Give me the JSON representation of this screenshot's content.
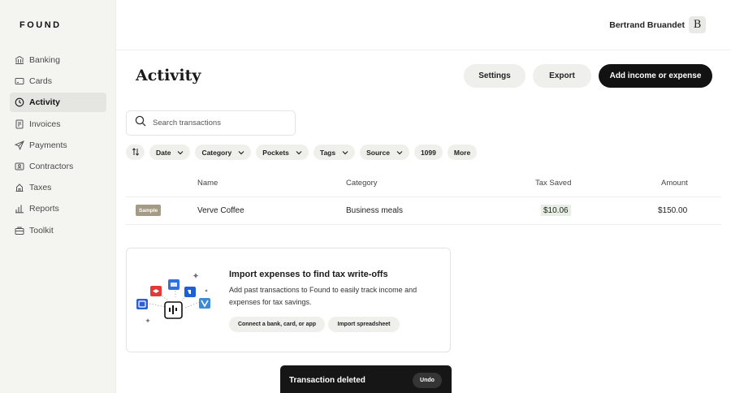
{
  "brand": {
    "logo_text": "FOUND"
  },
  "sidebar": {
    "items": [
      {
        "label": "Banking",
        "icon": "bank-icon",
        "active": false
      },
      {
        "label": "Cards",
        "icon": "card-icon",
        "active": false
      },
      {
        "label": "Activity",
        "icon": "clock-icon",
        "active": true
      },
      {
        "label": "Invoices",
        "icon": "invoice-icon",
        "active": false
      },
      {
        "label": "Payments",
        "icon": "send-icon",
        "active": false
      },
      {
        "label": "Contractors",
        "icon": "contractors-icon",
        "active": false
      },
      {
        "label": "Taxes",
        "icon": "taxes-icon",
        "active": false
      },
      {
        "label": "Reports",
        "icon": "bar-chart-icon",
        "active": false
      },
      {
        "label": "Toolkit",
        "icon": "toolkit-icon",
        "active": false
      }
    ]
  },
  "header": {
    "user_name": "Bertrand Bruandet",
    "avatar_letter": "B"
  },
  "main": {
    "title": "Activity",
    "buttons": {
      "settings": "Settings",
      "export": "Export",
      "add": "Add income or expense"
    },
    "search": {
      "placeholder": "Search transactions",
      "value": ""
    },
    "filters": {
      "date": "Date",
      "category": "Category",
      "pockets": "Pockets",
      "tags": "Tags",
      "source": "Source",
      "form_1099": "1099",
      "more": "More"
    },
    "table": {
      "columns": {
        "name": "Name",
        "category": "Category",
        "tax_saved": "Tax Saved",
        "amount": "Amount"
      },
      "rows": [
        {
          "badge": "Sample",
          "name": "Verve Coffee",
          "category": "Business meals",
          "tax_saved": "$10.06",
          "amount": "$150.00"
        }
      ]
    }
  },
  "import_card": {
    "title": "Import expenses to find tax write-offs",
    "body": "Add past transactions to Found to easily track income and expenses for tax savings.",
    "connect_button": "Connect a bank, card, or app",
    "import_button": "Import spreadsheet"
  },
  "toast": {
    "message": "Transaction deleted",
    "undo": "Undo"
  },
  "colors": {
    "sidebar_bg": "#f4f4f1",
    "primary_button": "#121212",
    "sample_badge": "#a59a86",
    "tax_chip": "#e7efe5"
  }
}
